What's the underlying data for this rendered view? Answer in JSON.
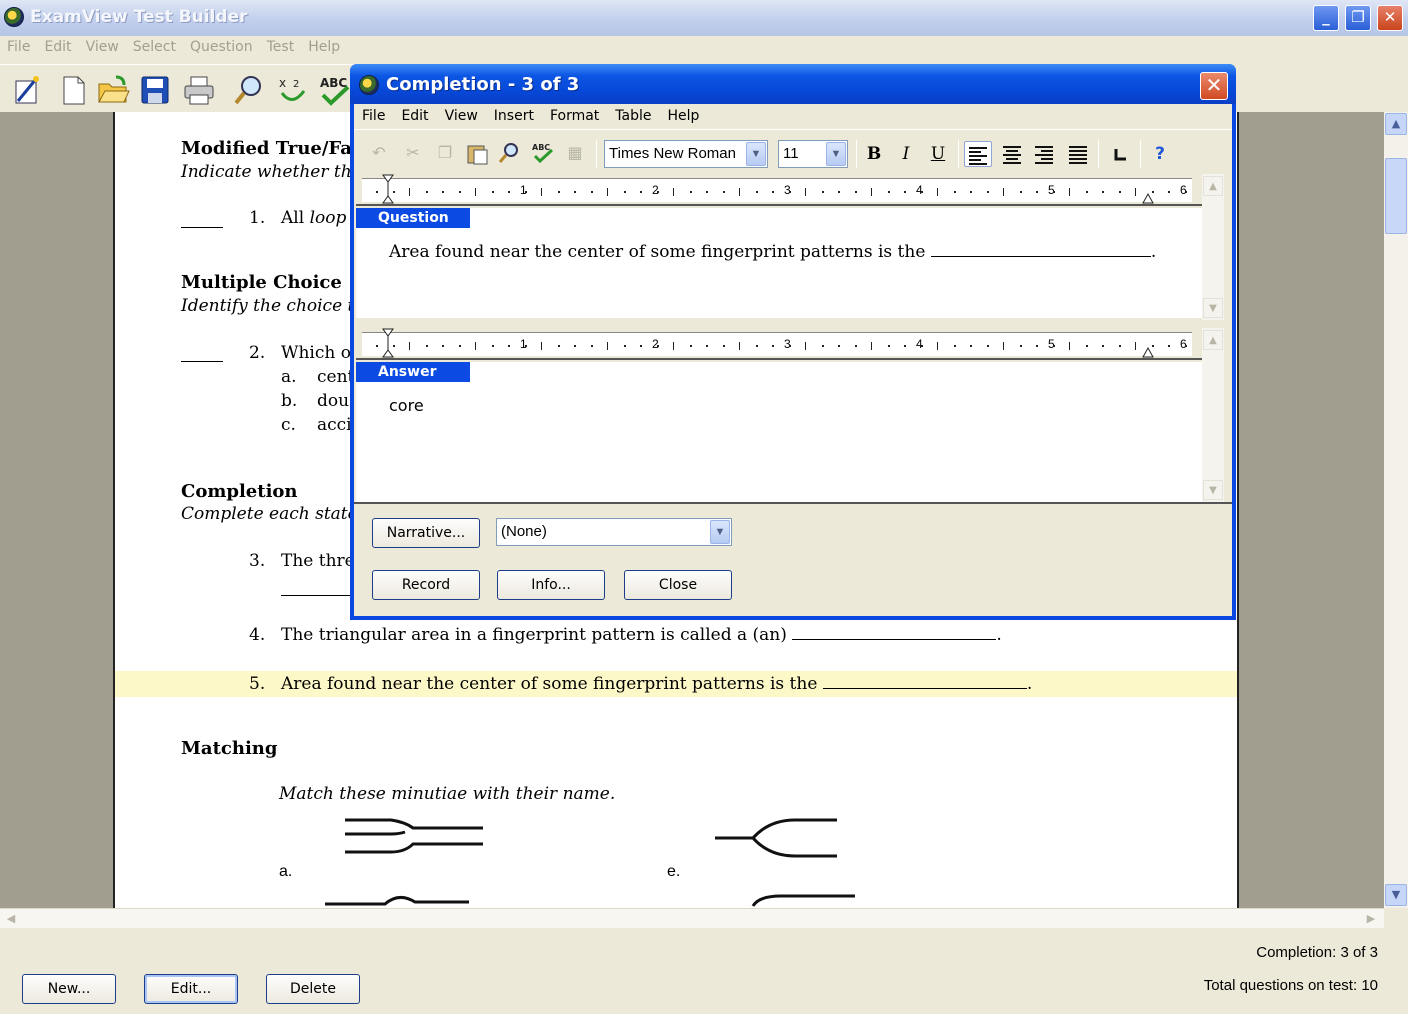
{
  "window": {
    "title": "ExamView Test Builder",
    "minimize": "_",
    "restore": "❐",
    "close": "✕"
  },
  "menu": [
    "File",
    "Edit",
    "View",
    "Select",
    "Question",
    "Test",
    "Help"
  ],
  "toolbar_icons": [
    "wizard-icon",
    "new-document-icon",
    "open-folder-icon",
    "save-icon",
    "print-icon",
    "find-icon",
    "scramble-icon",
    "spellcheck-icon"
  ],
  "document": {
    "sections": {
      "tf": {
        "title": "Modified True/Fals",
        "instruction": "Indicate whether the",
        "q_num": "1.",
        "q_text": "All ",
        "q_italic": "loop"
      },
      "mc": {
        "title": "Multiple Choice",
        "instruction": "Identify the choice th",
        "q_num": "2.",
        "q_text": "Which o",
        "choices": [
          {
            "letter": "a.",
            "text": "cent"
          },
          {
            "letter": "b.",
            "text": "dou"
          },
          {
            "letter": "c.",
            "text": "acci"
          }
        ]
      },
      "comp": {
        "title": "Completion",
        "instruction": "Complete each stater",
        "q3_num": "3.",
        "q3_text": "The thre",
        "q4_num": "4.",
        "q4_text": "The triangular area in a fingerprint pattern is called a (an)",
        "q5_num": "5.",
        "q5_text": "Area found near the center of some fingerprint patterns is the"
      },
      "match": {
        "title": "Matching",
        "instruction": "Match these minutiae with their name.",
        "label_a": "a.",
        "label_e": "e."
      }
    }
  },
  "dialog": {
    "title": "Completion - 3 of 3",
    "close": "✕",
    "menu": [
      "File",
      "Edit",
      "View",
      "Insert",
      "Format",
      "Table",
      "Help"
    ],
    "font_name": "Times New Roman",
    "font_size": "11",
    "format_bold": "B",
    "format_italic": "I",
    "format_underline": "U",
    "help_symbol": "?",
    "question_label": "Question",
    "question_text": "Area found near the center of some fingerprint patterns is the",
    "answer_label": "Answer",
    "answer_text": "core",
    "ruler_numbers": [
      "1",
      "2",
      "3",
      "4",
      "5",
      "6"
    ],
    "narrative_button": "Narrative...",
    "narrative_select": "(None)",
    "record_button": "Record",
    "info_button": "Info...",
    "close_button": "Close"
  },
  "bottom": {
    "new_button": "New...",
    "edit_button": "Edit...",
    "delete_button": "Delete",
    "status_completion": "Completion: 3 of 3",
    "status_total": "Total questions on test: 10"
  }
}
